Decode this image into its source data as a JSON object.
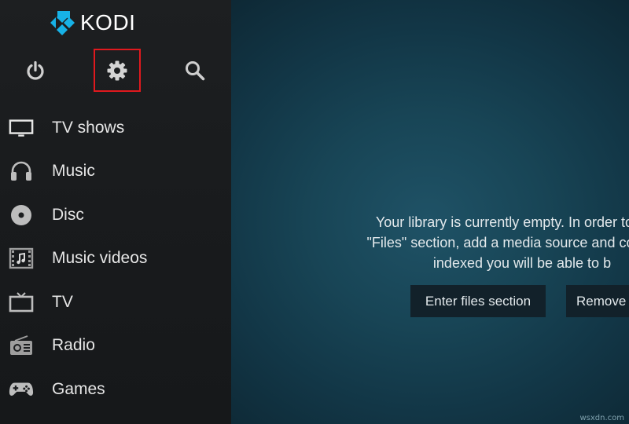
{
  "app": {
    "name": "KODI"
  },
  "colors": {
    "highlight": "#e0191e",
    "sidebar": "#1b1d1f",
    "main": "#184556",
    "logo_blue": "#17b2e7"
  },
  "topbar": {
    "icons": [
      "power-icon",
      "gear-icon",
      "search-icon"
    ]
  },
  "sidebar": {
    "items": [
      {
        "label": "TV shows",
        "icon": "tv-shows-icon"
      },
      {
        "label": "Music",
        "icon": "headphones-icon"
      },
      {
        "label": "Disc",
        "icon": "disc-icon"
      },
      {
        "label": "Music videos",
        "icon": "music-videos-icon"
      },
      {
        "label": "TV",
        "icon": "tv-icon"
      },
      {
        "label": "Radio",
        "icon": "radio-icon"
      },
      {
        "label": "Games",
        "icon": "gamepad-icon"
      }
    ]
  },
  "main": {
    "message_lines": [
      "Your library is currently empty. In order to popu",
      "\"Files\" section, add a media source and configure",
      "indexed you will be able to b"
    ],
    "enter_files_label": "Enter files section",
    "remove_label": "Remove"
  },
  "watermark": "wsxdn.com"
}
